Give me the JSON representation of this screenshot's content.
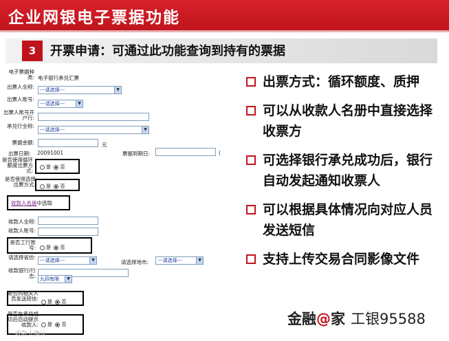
{
  "title": "企业网银电子票据功能",
  "section": {
    "number": "3",
    "text": "开票申请：可通过此功能查询到持有的票据"
  },
  "form": {
    "bill_type_label": "电子票据种类:",
    "bill_type_value": "电子银行承兑汇票",
    "drawer_name_label": "出票人全称:",
    "drawer_name_select": "---请选择---",
    "drawer_account_label": "出票人账号:",
    "drawer_account_select": "---请选择---",
    "drawer_bank_label": "出票人账号开户行:",
    "acceptor_label": "承兑行全称:",
    "acceptor_select": "---请选择---",
    "amount_label": "票据金额:",
    "amount_unit": "元",
    "issue_date_label": "出票日期:",
    "issue_date_value": "20091001",
    "due_date_label": "票据到期日:",
    "due_suffix": "(",
    "cycle_label": "是否使用循环额度出票方式:",
    "yes": "是",
    "no": "否",
    "select_payee_label": "是否使用选择出票方式:",
    "payee_roster_link": "收款人名册",
    "payee_roster_suffix": "中选取",
    "payee_name_label": "收款人全称:",
    "payee_account_label": "收款人账号:",
    "icbc_account_label": "是否工行账号:",
    "province_label": "请选择省份:",
    "province_select": "---请选择---",
    "city_label": "请选择地市:",
    "city_select": "---请选择---",
    "payee_bank_label": "收款银行/行志:",
    "payee_bank_select": "九四有限",
    "notify_label": "是否向相关人员发送短信:",
    "auto_notify_label": "是否在承兑成功后自动提示收款人:",
    "watermark": "收款人确认"
  },
  "bullets": [
    "出票方式：循环额度、质押",
    "可以从收款人名册中直接选择收票方",
    "可选择银行承兑成功后，银行自动发起通知收票人",
    "可以根据具体情况向对应人员发送短信",
    "支持上传交易合同影像文件"
  ],
  "brand": {
    "name": "金融",
    "at": "@",
    "home": "家",
    "hotline": "工银95588"
  },
  "colors": {
    "accent": "#c0141d",
    "link": "#7a2a8a"
  }
}
